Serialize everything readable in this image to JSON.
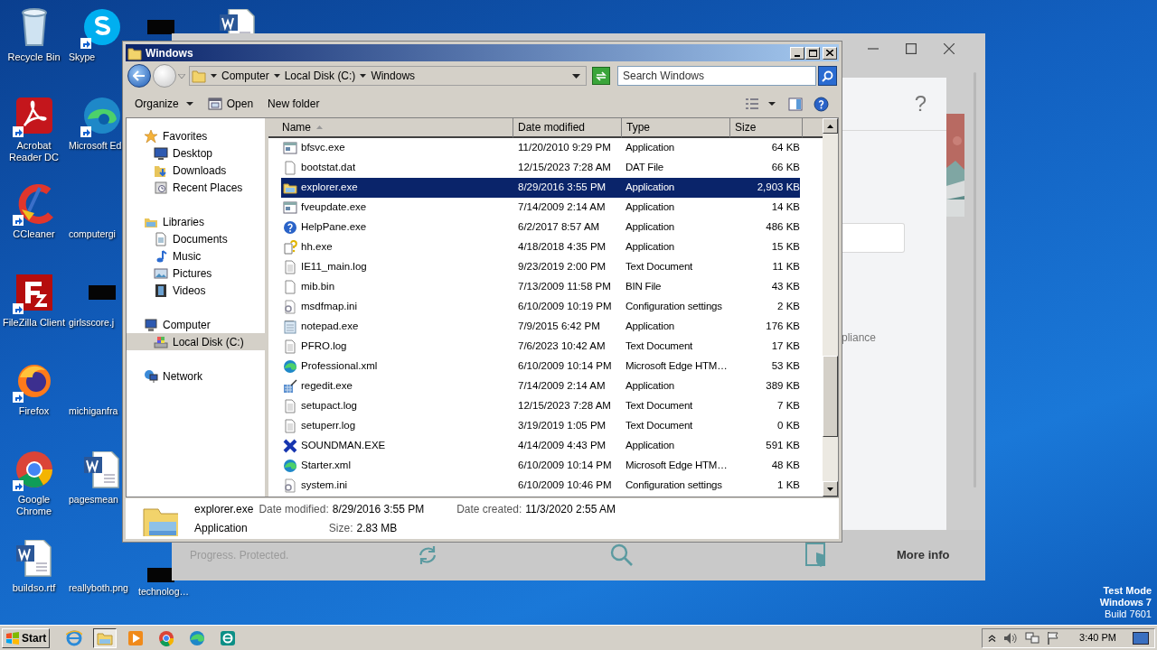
{
  "desktop_columns": [
    [
      {
        "label": "Recycle Bin",
        "kind": "recycle",
        "shortcut": false
      },
      {
        "label": "Acrobat Reader DC",
        "kind": "acrobat",
        "shortcut": true
      },
      {
        "label": "CCleaner",
        "kind": "ccleaner",
        "shortcut": true
      },
      {
        "label": "FileZilla Client",
        "kind": "filezilla",
        "shortcut": true
      },
      {
        "label": "Firefox",
        "kind": "firefox",
        "shortcut": true
      },
      {
        "label": "Google Chrome",
        "kind": "chrome",
        "shortcut": true
      },
      {
        "label": "buildso.rtf",
        "kind": "word",
        "shortcut": false
      }
    ],
    [
      {
        "label": "Skype",
        "kind": "skype",
        "shortcut": true
      },
      {
        "label": "Microsoft Ed",
        "kind": "edge",
        "shortcut": true
      },
      {
        "label": "computergi",
        "kind": "none",
        "shortcut": false
      },
      {
        "label": "girlsscore.j",
        "kind": "thumbnail",
        "shortcut": false
      },
      {
        "label": "michiganfra",
        "kind": "none",
        "shortcut": false
      },
      {
        "label": "pagesmean",
        "kind": "word",
        "shortcut": false
      },
      {
        "label": "reallyboth.png",
        "kind": "none",
        "shortcut": false
      }
    ],
    [
      {
        "kind": "thumbnail"
      },
      {
        "label": "technolog…",
        "kind": "thumbnail",
        "shortcut": false
      }
    ],
    [
      {
        "kind": "word"
      }
    ]
  ],
  "background_window": {
    "help": "?",
    "partial_text": "pliance",
    "footer_text": "Progress. Protected.",
    "more_info": "More info"
  },
  "explorer": {
    "title": "Windows",
    "breadcrumbs": [
      "Computer",
      "Local Disk (C:)",
      "Windows"
    ],
    "search": {
      "placeholder": "Search Windows"
    },
    "toolbar": [
      {
        "label": "Organize",
        "kind": "menu"
      },
      {
        "label": "Open",
        "kind": "open"
      },
      {
        "label": "New folder",
        "kind": "plain"
      }
    ],
    "nav": [
      {
        "label": "Favorites",
        "kind": "star",
        "selected": false,
        "children": [
          {
            "label": "Desktop",
            "kind": "desktop",
            "selected": false
          },
          {
            "label": "Downloads",
            "kind": "downloads",
            "selected": false
          },
          {
            "label": "Recent Places",
            "kind": "recent",
            "selected": false
          }
        ]
      },
      {
        "label": "Libraries",
        "kind": "libraries",
        "selected": false,
        "children": [
          {
            "label": "Documents",
            "kind": "documents",
            "selected": false
          },
          {
            "label": "Music",
            "kind": "music",
            "selected": false
          },
          {
            "label": "Pictures",
            "kind": "pictures",
            "selected": false
          },
          {
            "label": "Videos",
            "kind": "videos",
            "selected": false
          }
        ]
      },
      {
        "label": "Computer",
        "kind": "computer",
        "selected": false,
        "children": [
          {
            "label": "Local Disk (C:)",
            "kind": "disk",
            "selected": true
          }
        ]
      },
      {
        "label": "Network",
        "kind": "network",
        "selected": false
      }
    ],
    "columns": [
      {
        "label": "Name",
        "sorted": true
      },
      {
        "label": "Date modified",
        "sorted": false
      },
      {
        "label": "Type",
        "sorted": false
      },
      {
        "label": "Size",
        "sorted": false
      }
    ],
    "files": [
      {
        "name": "bfsvc.exe",
        "date": "11/20/2010 9:29 PM",
        "type": "Application",
        "size": "64 KB",
        "kind": "app",
        "selected": false
      },
      {
        "name": "bootstat.dat",
        "date": "12/15/2023 7:28 AM",
        "type": "DAT File",
        "size": "66 KB",
        "kind": "blank",
        "selected": false
      },
      {
        "name": "explorer.exe",
        "date": "8/29/2016 3:55 PM",
        "type": "Application",
        "size": "2,903 KB",
        "kind": "folder",
        "selected": true
      },
      {
        "name": "fveupdate.exe",
        "date": "7/14/2009 2:14 AM",
        "type": "Application",
        "size": "14 KB",
        "kind": "app",
        "selected": false
      },
      {
        "name": "HelpPane.exe",
        "date": "6/2/2017 8:57 AM",
        "type": "Application",
        "size": "486 KB",
        "kind": "help",
        "selected": false
      },
      {
        "name": "hh.exe",
        "date": "4/18/2018 4:35 PM",
        "type": "Application",
        "size": "15 KB",
        "kind": "hh",
        "selected": false
      },
      {
        "name": "IE11_main.log",
        "date": "9/23/2019 2:00 PM",
        "type": "Text Document",
        "size": "11 KB",
        "kind": "text",
        "selected": false
      },
      {
        "name": "mib.bin",
        "date": "7/13/2009 11:58 PM",
        "type": "BIN File",
        "size": "43 KB",
        "kind": "blank",
        "selected": false
      },
      {
        "name": "msdfmap.ini",
        "date": "6/10/2009 10:19 PM",
        "type": "Configuration settings",
        "size": "2 KB",
        "kind": "settings",
        "selected": false
      },
      {
        "name": "notepad.exe",
        "date": "7/9/2015 6:42 PM",
        "type": "Application",
        "size": "176 KB",
        "kind": "notepad",
        "selected": false
      },
      {
        "name": "PFRO.log",
        "date": "7/6/2023 10:42 AM",
        "type": "Text Document",
        "size": "17 KB",
        "kind": "text",
        "selected": false
      },
      {
        "name": "Professional.xml",
        "date": "6/10/2009 10:14 PM",
        "type": "Microsoft Edge HTM…",
        "size": "53 KB",
        "kind": "edge",
        "selected": false
      },
      {
        "name": "regedit.exe",
        "date": "7/14/2009 2:14 AM",
        "type": "Application",
        "size": "389 KB",
        "kind": "regedit",
        "selected": false
      },
      {
        "name": "setupact.log",
        "date": "12/15/2023 7:28 AM",
        "type": "Text Document",
        "size": "7 KB",
        "kind": "text",
        "selected": false
      },
      {
        "name": "setuperr.log",
        "date": "3/19/2019 1:05 PM",
        "type": "Text Document",
        "size": "0 KB",
        "kind": "text",
        "selected": false
      },
      {
        "name": "SOUNDMAN.EXE",
        "date": "4/14/2009 4:43 PM",
        "type": "Application",
        "size": "591 KB",
        "kind": "soundman",
        "selected": false
      },
      {
        "name": "Starter.xml",
        "date": "6/10/2009 10:14 PM",
        "type": "Microsoft Edge HTM…",
        "size": "48 KB",
        "kind": "edge",
        "selected": false
      },
      {
        "name": "system.ini",
        "date": "6/10/2009 10:46 PM",
        "type": "Configuration settings",
        "size": "1 KB",
        "kind": "settings",
        "selected": false
      }
    ],
    "details": {
      "name": "explorer.exe",
      "type": "Application",
      "fields": [
        {
          "label": "Date modified:",
          "value": "8/29/2016 3:55 PM"
        },
        {
          "label": "Date created:",
          "value": "11/3/2020 2:55 AM"
        },
        {
          "label": "Size:",
          "value": "2.83 MB"
        }
      ]
    }
  },
  "os_notice": [
    "Test Mode",
    "Windows 7",
    "Build 7601"
  ],
  "taskbar": {
    "start": "Start",
    "apps": [
      {
        "kind": "ie",
        "active": false
      },
      {
        "kind": "explorer",
        "active": true
      },
      {
        "kind": "media",
        "active": false
      },
      {
        "kind": "chrome",
        "active": false
      },
      {
        "kind": "edge",
        "active": false
      },
      {
        "kind": "eset",
        "active": false
      }
    ],
    "clock": "3:40 PM"
  }
}
